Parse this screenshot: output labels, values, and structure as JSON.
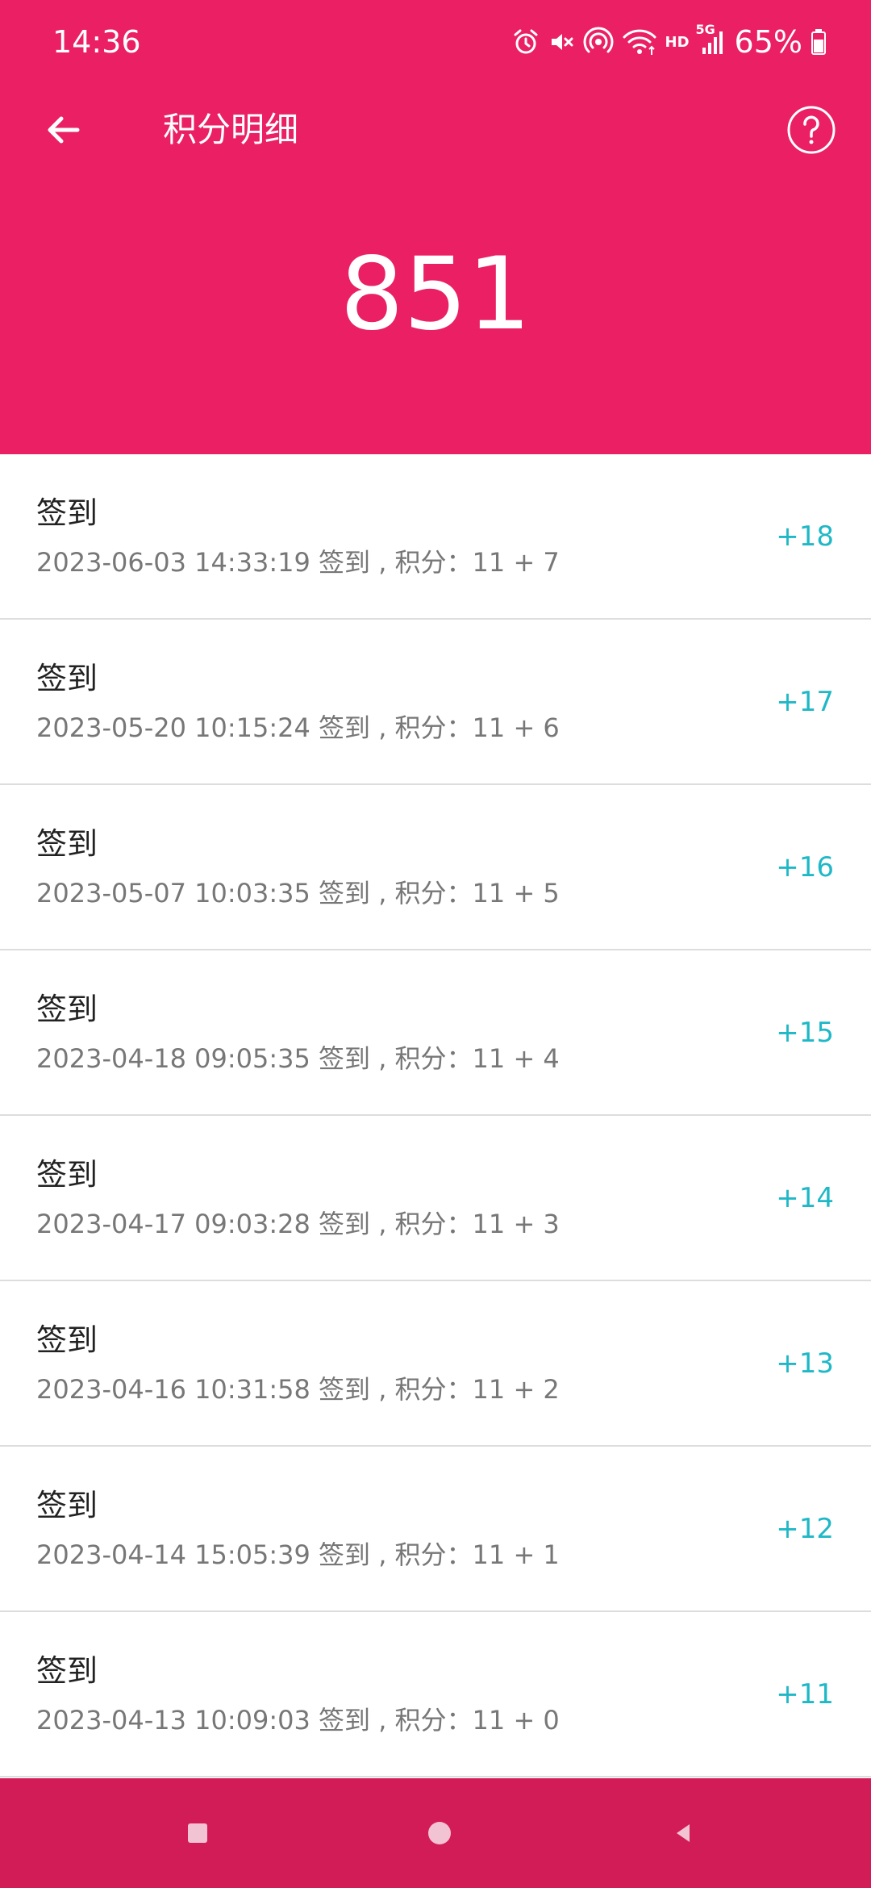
{
  "status_bar": {
    "time": "14:36",
    "hd_label": "HD",
    "network_label": "5G",
    "battery": "65%",
    "icons": [
      "alarm-icon",
      "mute-icon",
      "hotspot-icon",
      "wifi-icon",
      "signal-icon",
      "battery-icon"
    ]
  },
  "toolbar": {
    "title": "积分明细",
    "back_icon": "arrow-left-icon",
    "help_icon": "help-circle-icon"
  },
  "summary": {
    "total_points": "851"
  },
  "records": [
    {
      "title": "签到",
      "desc": "2023-06-03 14:33:19 签到 , 积分：11 + 7",
      "points": "+18"
    },
    {
      "title": "签到",
      "desc": "2023-05-20 10:15:24 签到 , 积分：11 + 6",
      "points": "+17"
    },
    {
      "title": "签到",
      "desc": "2023-05-07 10:03:35 签到 , 积分：11 + 5",
      "points": "+16"
    },
    {
      "title": "签到",
      "desc": "2023-04-18 09:05:35 签到 , 积分：11 + 4",
      "points": "+15"
    },
    {
      "title": "签到",
      "desc": "2023-04-17 09:03:28 签到 , 积分：11 + 3",
      "points": "+14"
    },
    {
      "title": "签到",
      "desc": "2023-04-16 10:31:58 签到 , 积分：11 + 2",
      "points": "+13"
    },
    {
      "title": "签到",
      "desc": "2023-04-14 15:05:39 签到 , 积分：11 + 1",
      "points": "+12"
    },
    {
      "title": "签到",
      "desc": "2023-04-13 10:09:03 签到 , 积分：11 + 0",
      "points": "+11"
    }
  ],
  "nav_bar": {
    "icons": [
      "recents-icon",
      "home-icon",
      "back-icon"
    ]
  },
  "colors": {
    "header_bg": "#EA1F64",
    "nav_bg": "#D21C57",
    "points_accent": "#1FB8C6",
    "title_text": "#222222",
    "desc_text": "#777777"
  }
}
